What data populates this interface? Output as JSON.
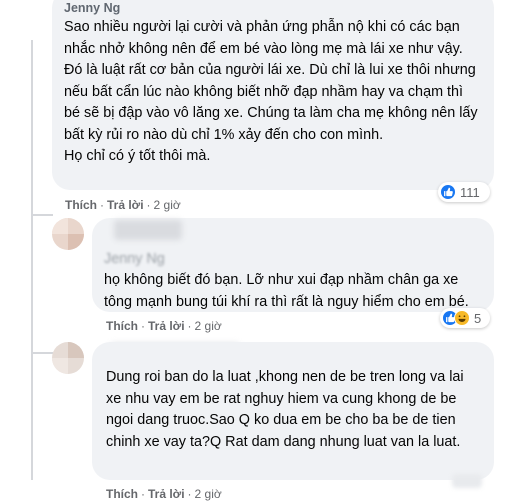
{
  "comments": [
    {
      "name": "Jenny Ng",
      "text": "Sao nhiều người lại cười và phản ứng phẫn nộ khi có các bạn nhắc nhở không nên để em bé vào lòng mẹ mà lái xe như vậy. Đó là luật rất cơ bản của người lái xe. Dù chỉ là lui xe thôi nhưng nếu bất cẩn lúc nào không biết nhỡ đạp nhầm hay va chạm thì bé sẽ bị đập vào vô lăng xe. Chúng ta làm cha mẹ không nên lấy bất kỳ rủi ro nào dù chỉ 1% xảy đến cho con mình.\nHọ chỉ có ý tốt thôi mà.",
      "like_label": "Thích",
      "reply_label": "Trả lời",
      "time": "2 giờ",
      "reaction_count": "111",
      "reaction_icons": [
        "like-icon"
      ]
    },
    {
      "name": "Jenny Ng",
      "text": "họ không biết đó bạn. Lỡ như xui đạp nhầm chân ga xe tông mạnh bung túi khí ra thì rất là nguy hiểm cho em bé.",
      "like_label": "Thích",
      "reply_label": "Trả lời",
      "time": "2 giờ",
      "reaction_count": "5",
      "reaction_icons": [
        "like-icon",
        "haha-icon"
      ]
    },
    {
      "text": "Dung roi ban do la luat ,khong nen de be tren long va lai xe nhu vay em be rat nghuy hiem va cung khong de be ngoi dang truoc.Sao Q ko dua em be cho ba be de tien chinh xe vay ta?Q Rat dam dang nhung luat van la luat.",
      "like_label": "Thích",
      "reply_label": "Trả lời",
      "time": "2 giờ"
    }
  ],
  "colors": {
    "bubble": "#f0f2f5",
    "like": "#1877f2",
    "haha": "#f7b928",
    "meta": "#65676b"
  }
}
